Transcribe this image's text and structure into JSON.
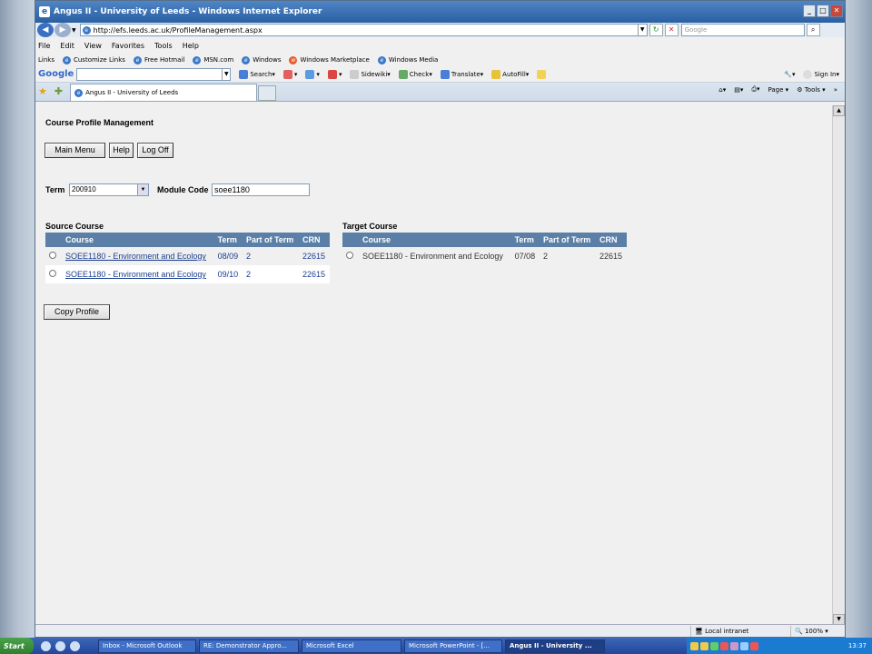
{
  "window": {
    "title": "Angus II - University of Leeds - Windows Internet Explorer"
  },
  "address": {
    "url": "http://efs.leeds.ac.uk/ProfileManagement.aspx",
    "search_placeholder": "Google"
  },
  "menu": [
    "File",
    "Edit",
    "View",
    "Favorites",
    "Tools",
    "Help"
  ],
  "links": {
    "label": "Links",
    "items": [
      "Customize Links",
      "Free Hotmail",
      "MSN.com",
      "Windows",
      "Windows Marketplace",
      "Windows Media"
    ]
  },
  "google_toolbar": {
    "logo": "Google",
    "items": [
      "Search",
      "Sidewiki",
      "Check",
      "Translate",
      "AutoFill"
    ],
    "sign_in": "Sign In"
  },
  "tab": {
    "label": "Angus II - University of Leeds"
  },
  "command_bar": {
    "page": "Page",
    "tools": "Tools"
  },
  "page": {
    "title": "Course Profile Management",
    "buttons": {
      "main_menu": "Main Menu",
      "help": "Help",
      "log_off": "Log Off",
      "copy_profile": "Copy Profile"
    },
    "term_label": "Term",
    "term_value": "200910",
    "module_code_label": "Module Code",
    "module_code_value": "soee1180"
  },
  "source_course": {
    "title": "Source Course",
    "headers": [
      "Course",
      "Term",
      "Part of Term",
      "CRN"
    ],
    "rows": [
      {
        "course": "SOEE1180 - Environment and Ecology",
        "term": "08/09",
        "part": "2",
        "crn": "22615"
      },
      {
        "course": "SOEE1180 - Environment and Ecology",
        "term": "09/10",
        "part": "2",
        "crn": "22615"
      }
    ]
  },
  "target_course": {
    "title": "Target Course",
    "headers": [
      "Course",
      "Term",
      "Part of Term",
      "CRN"
    ],
    "rows": [
      {
        "course": "SOEE1180 - Environment and Ecology",
        "term": "07/08",
        "part": "2",
        "crn": "22615"
      }
    ]
  },
  "status": {
    "zone": "Local intranet",
    "zoom": "100%"
  },
  "taskbar": {
    "start": "Start",
    "tasks": [
      "Inbox - Microsoft Outlook",
      "RE: Demonstrator Appro...",
      "Microsoft Excel",
      "Microsoft PowerPoint - [...",
      "Angus II - University ..."
    ],
    "clock": "13:37"
  }
}
